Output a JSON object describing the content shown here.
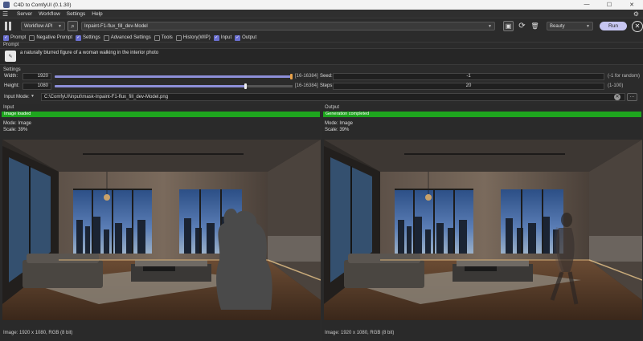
{
  "window": {
    "title": "C4D to ComfyUI (0.1.30)",
    "buttons": [
      "—",
      "☐",
      "✕"
    ]
  },
  "menu": {
    "items": [
      "Server",
      "Workflow",
      "Settings",
      "Help"
    ]
  },
  "toolbar": {
    "workflow_type": "Workflow API",
    "workflow_name": "Inpaint-F1-flux_fill_dev-Model",
    "preset": "Beauty",
    "run_label": "Run"
  },
  "checkboxes": [
    {
      "label": "Prompt",
      "checked": true
    },
    {
      "label": "Negative Prompt",
      "checked": false
    },
    {
      "label": "Settings",
      "checked": true
    },
    {
      "label": "Advanced Settings",
      "checked": false
    },
    {
      "label": "Tools",
      "checked": false
    },
    {
      "label": "History(WIP)",
      "checked": false
    },
    {
      "label": "Input",
      "checked": true
    },
    {
      "label": "Output",
      "checked": true
    }
  ],
  "prompt": {
    "label": "Prompt",
    "text": "a naturally blurred figure of a woman walking in the interior photo"
  },
  "settings": {
    "label": "Settings",
    "width": {
      "label": "Width:",
      "value": "1920",
      "range": "[16-16384]",
      "fraction": 1.0
    },
    "height": {
      "label": "Height:",
      "value": "1080",
      "range": "[16-16384]",
      "fraction": 0.8
    },
    "seed": {
      "label": "Seed:",
      "value": "-1",
      "hint": "(-1 for random)"
    },
    "steps": {
      "label": "Steps:",
      "value": "20",
      "hint": "(1-100)"
    }
  },
  "input_mode": {
    "label": "Input Mode:",
    "path": "C:\\ComfyUI\\input\\mask-Inpaint-F1-flux_fill_dev-Model.png"
  },
  "input_panel": {
    "label": "Input",
    "status": "Image loaded",
    "mode": "Mode: Image",
    "scale": "Scale: 39%",
    "caption": "Image: 1920 x 1080, RGB (8 bit)"
  },
  "output_panel": {
    "label": "Output",
    "status": "Generation completed",
    "mode": "Mode: Image",
    "scale": "Scale: 39%",
    "caption": "Image: 1920 x 1080, RGB (8 bit)"
  },
  "colors": {
    "accent": "#8d8fd8",
    "status_green": "#1ea51e",
    "run_button": "#c7c6f2"
  },
  "icons": [
    "app-icon",
    "hamburger-icon",
    "gear-icon",
    "pause-icon",
    "folder-search-icon",
    "save-icon",
    "refresh-icon",
    "trash-icon",
    "close-circle-icon",
    "dropdown-arrow-icon",
    "clear-icon"
  ]
}
